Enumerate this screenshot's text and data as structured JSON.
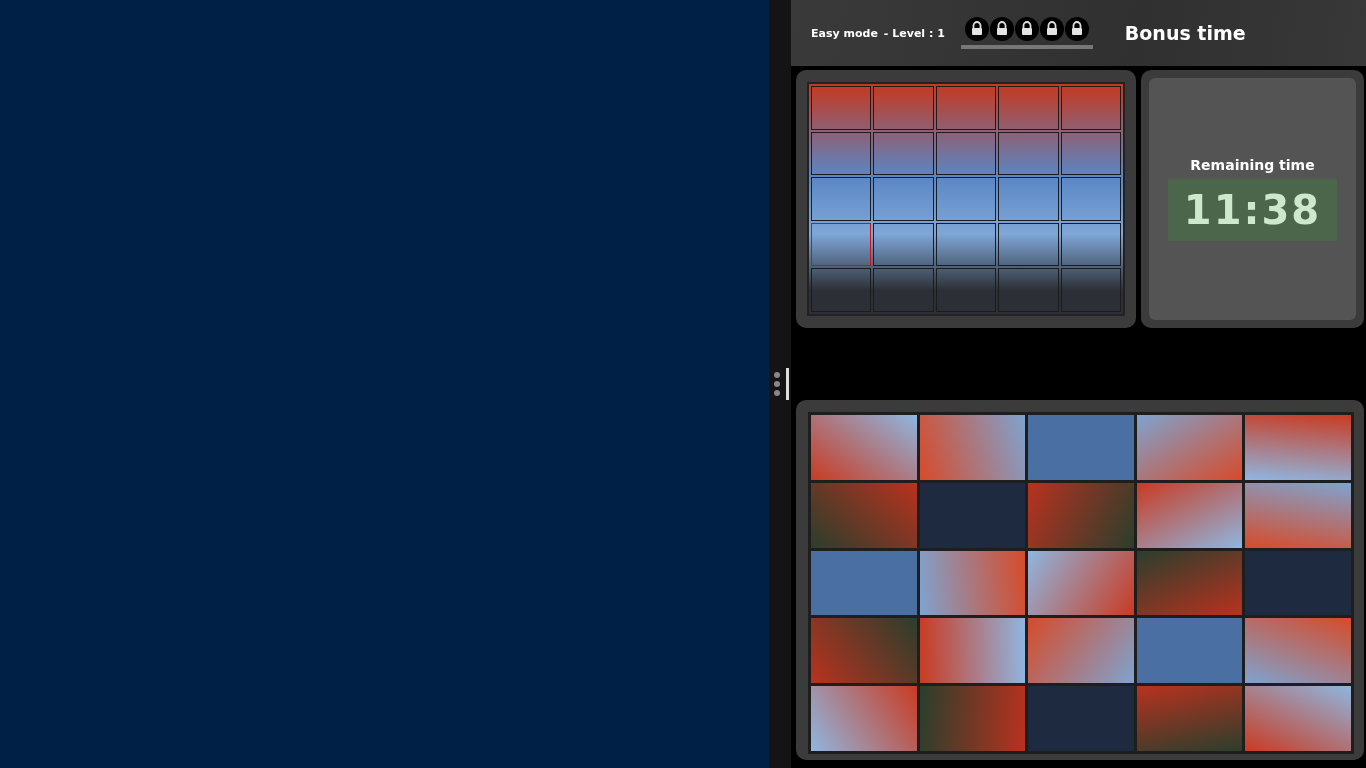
{
  "header": {
    "mode": "Easy mode",
    "level": "- Level : 1",
    "locks": [
      {
        "locked": true
      },
      {
        "locked": true
      },
      {
        "locked": true
      },
      {
        "locked": true
      },
      {
        "locked": true
      }
    ],
    "bonus": "Bonus time"
  },
  "board": {
    "cells": [
      {
        "selected": false
      },
      {
        "selected": false
      },
      {
        "selected": false
      },
      {
        "selected": false
      },
      {
        "selected": false
      },
      {
        "selected": false
      },
      {
        "selected": false
      },
      {
        "selected": false
      },
      {
        "selected": false
      },
      {
        "selected": false
      },
      {
        "selected": false
      },
      {
        "selected": false
      },
      {
        "selected": false
      },
      {
        "selected": false
      },
      {
        "selected": false
      },
      {
        "selected": true
      },
      {
        "selected": false
      },
      {
        "selected": false
      },
      {
        "selected": false
      },
      {
        "selected": false
      },
      {
        "selected": false
      },
      {
        "selected": false
      },
      {
        "selected": false
      },
      {
        "selected": false
      },
      {
        "selected": false
      }
    ]
  },
  "timer": {
    "label": "Remaining time",
    "value": "11:38"
  }
}
